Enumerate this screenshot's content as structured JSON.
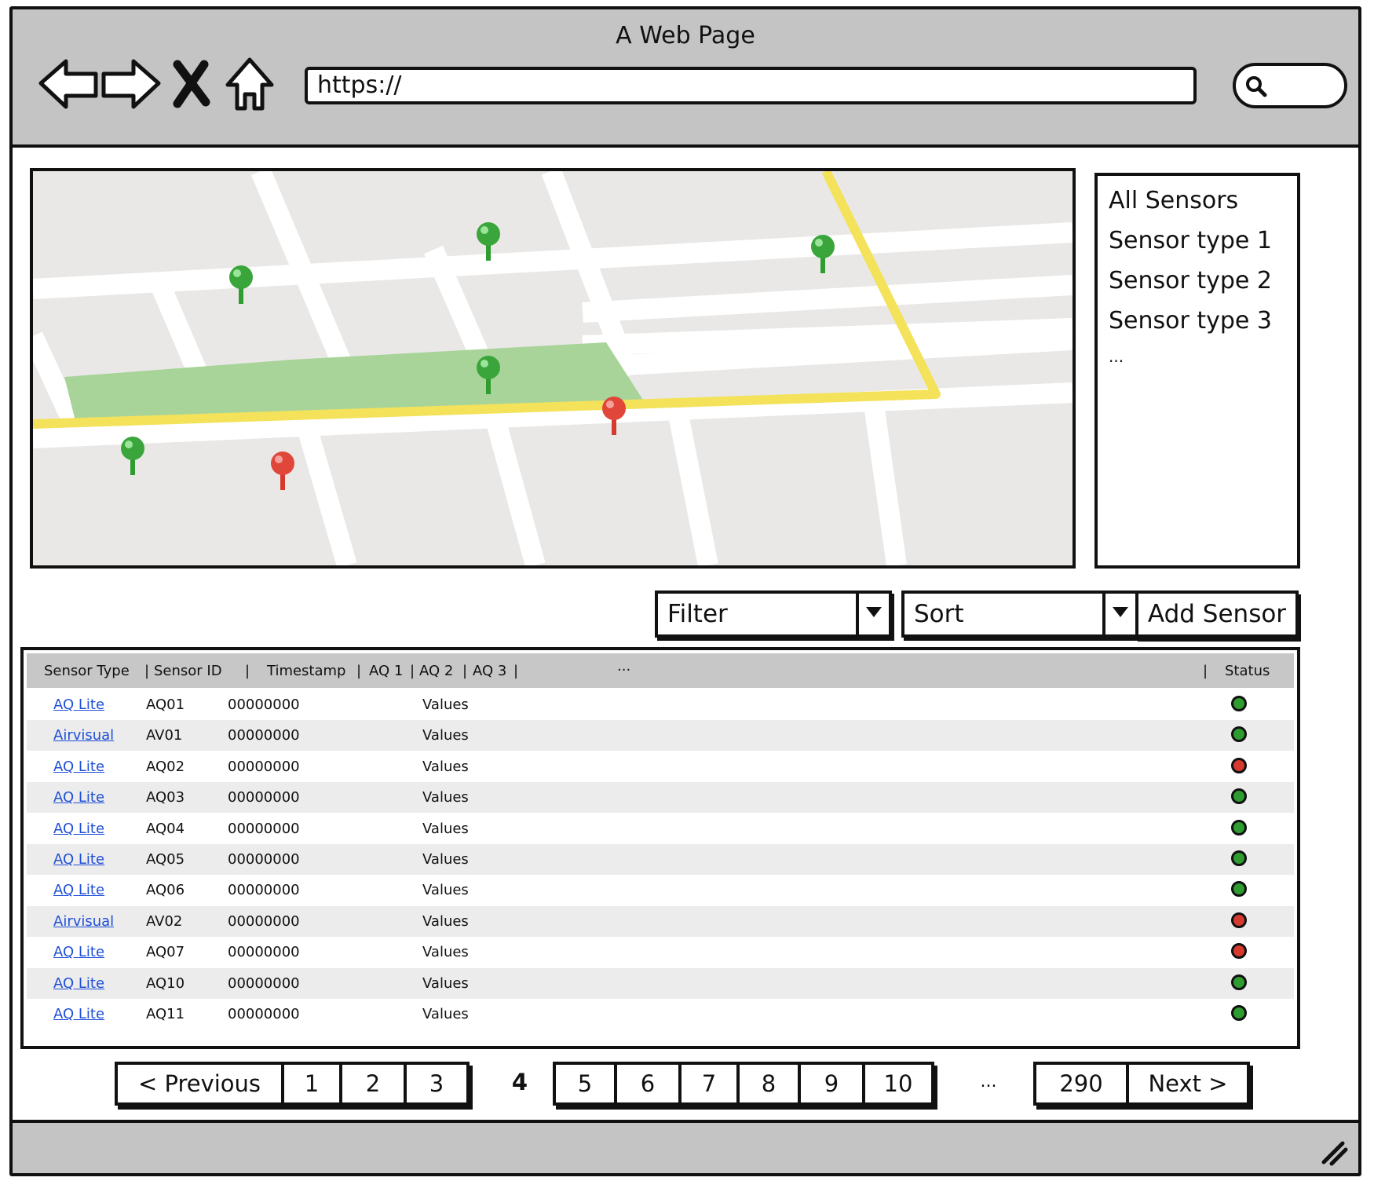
{
  "window": {
    "title": "A Web Page"
  },
  "browser": {
    "url": "https://",
    "back_icon": "back-arrow-icon",
    "forward_icon": "forward-arrow-icon",
    "stop_icon": "close-icon",
    "home_icon": "home-icon",
    "search_icon": "search-icon"
  },
  "map": {
    "markers": [
      {
        "status": "green"
      },
      {
        "status": "green"
      },
      {
        "status": "green"
      },
      {
        "status": "green"
      },
      {
        "status": "red"
      },
      {
        "status": "green"
      },
      {
        "status": "red"
      }
    ]
  },
  "sensor_filter_list": {
    "items": [
      "All Sensors",
      "Sensor type 1",
      "Sensor type 2",
      "Sensor type 3"
    ],
    "more": "..."
  },
  "controls": {
    "filter_label": "Filter",
    "sort_label": "Sort",
    "add_sensor_label": "Add Sensor"
  },
  "table": {
    "headers": {
      "sensor_type": "Sensor Type",
      "sensor_id": "Sensor ID",
      "timestamp": "Timestamp",
      "aq1": "AQ 1",
      "aq2": "AQ 2",
      "aq3": "AQ 3",
      "more": "...",
      "status": "Status"
    },
    "rows": [
      {
        "type": "AQ Lite",
        "id": "AQ01",
        "timestamp": "00000000",
        "values": "Values",
        "status": "green"
      },
      {
        "type": "Airvisual",
        "id": "AV01",
        "timestamp": "00000000",
        "values": "Values",
        "status": "green"
      },
      {
        "type": "AQ Lite",
        "id": "AQ02",
        "timestamp": "00000000",
        "values": "Values",
        "status": "red"
      },
      {
        "type": "AQ Lite",
        "id": "AQ03",
        "timestamp": "00000000",
        "values": "Values",
        "status": "green"
      },
      {
        "type": "AQ Lite",
        "id": "AQ04",
        "timestamp": "00000000",
        "values": "Values",
        "status": "green"
      },
      {
        "type": "AQ Lite",
        "id": "AQ05",
        "timestamp": "00000000",
        "values": "Values",
        "status": "green"
      },
      {
        "type": "AQ Lite",
        "id": "AQ06",
        "timestamp": "00000000",
        "values": "Values",
        "status": "green"
      },
      {
        "type": "Airvisual",
        "id": "AV02",
        "timestamp": "00000000",
        "values": "Values",
        "status": "red"
      },
      {
        "type": "AQ Lite",
        "id": "AQ07",
        "timestamp": "00000000",
        "values": "Values",
        "status": "red"
      },
      {
        "type": "AQ Lite",
        "id": "AQ10",
        "timestamp": "00000000",
        "values": "Values",
        "status": "green"
      },
      {
        "type": "AQ Lite",
        "id": "AQ11",
        "timestamp": "00000000",
        "values": "Values",
        "status": "green"
      }
    ]
  },
  "pagination": {
    "previous": "< Previous",
    "pages_a": [
      "1",
      "2",
      "3"
    ],
    "current": "4",
    "pages_b": [
      "5",
      "6",
      "7",
      "8",
      "9",
      "10"
    ],
    "ellipsis": "...",
    "last": "290",
    "next": "Next >"
  },
  "colors": {
    "status_green": "#2e9c2e",
    "status_red": "#d63a2f",
    "link": "#1e4fd8",
    "chrome_gray": "#c4c4c4",
    "map_park": "#a8d49a",
    "map_highway": "#f3e25a"
  }
}
